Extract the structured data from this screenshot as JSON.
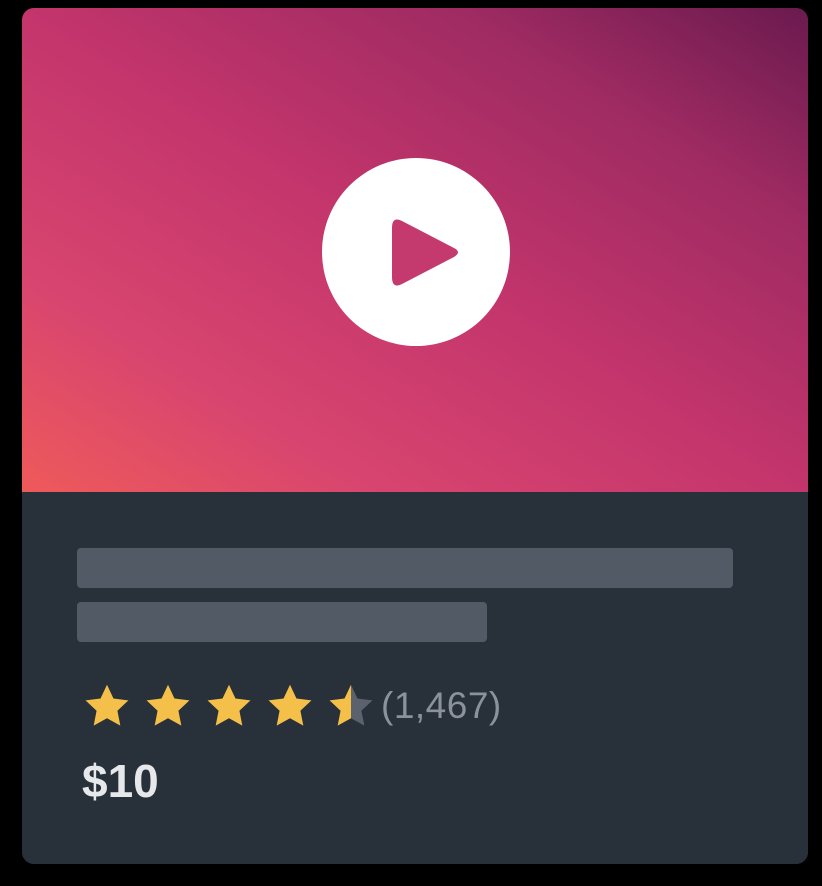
{
  "course_card": {
    "thumbnail": {
      "play_icon": "play-icon",
      "gradient_colors": [
        "#ee5a5a",
        "#c3356c",
        "#6a1a4f"
      ]
    },
    "rating": {
      "value": 4.5,
      "max": 5,
      "count_label": "(1,467)",
      "star_color": "#f5c04a",
      "empty_star_color": "#5b626d"
    },
    "price": "$10",
    "colors": {
      "card_background": "#283039",
      "skeleton": "#525a66",
      "page_background": "#000000"
    }
  }
}
